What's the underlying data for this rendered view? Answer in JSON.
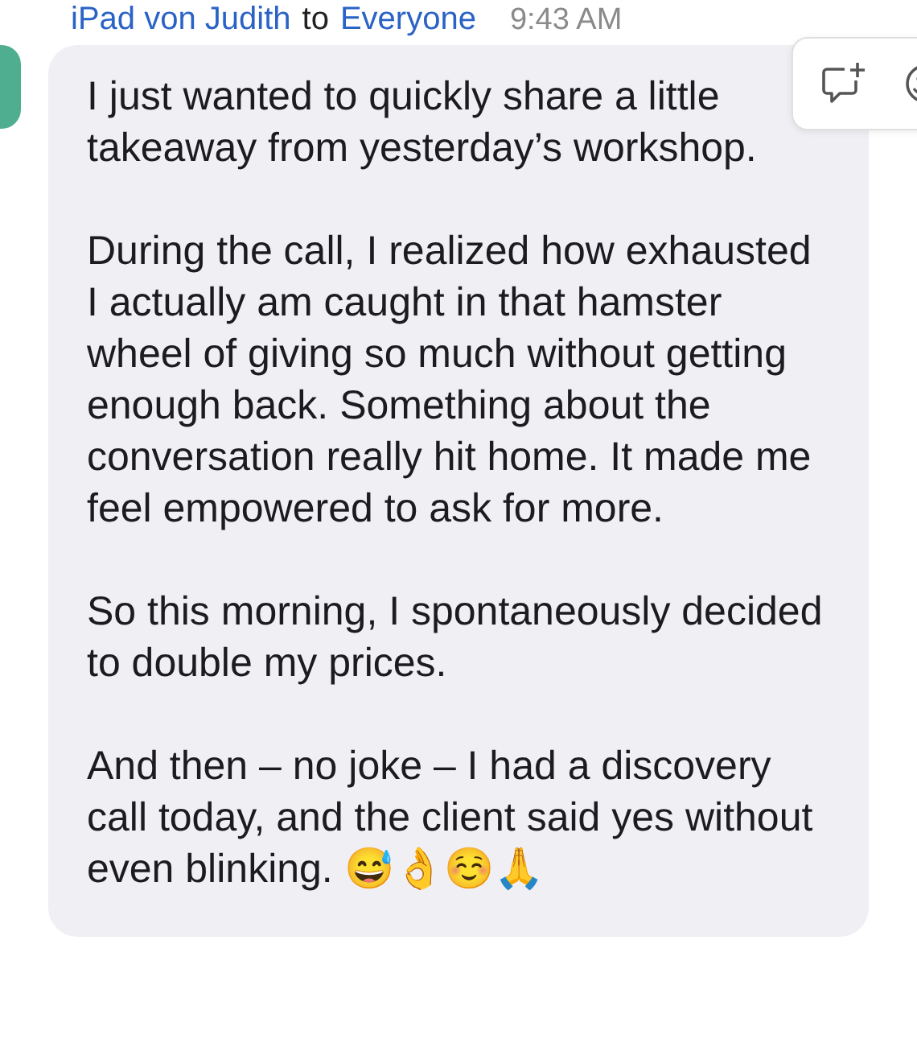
{
  "header": {
    "sender": "iPad von Judith",
    "connector": "to",
    "recipient": "Everyone",
    "time": "9:43 AM"
  },
  "message": {
    "paragraphs": [
      "I just wanted to quickly share a little takeaway from yesterday’s workshop.",
      "During the call, I realized how exhausted I actually am caught in that hamster wheel of giving so much without getting enough back. Something about the conversation really hit home. It made me feel empowered to ask for more.",
      "So this morning, I spontaneously decided to double my prices.",
      "And then – no joke – I had a discovery call today, and the client said yes without even blinking. 😅👌☺️🙏"
    ]
  }
}
